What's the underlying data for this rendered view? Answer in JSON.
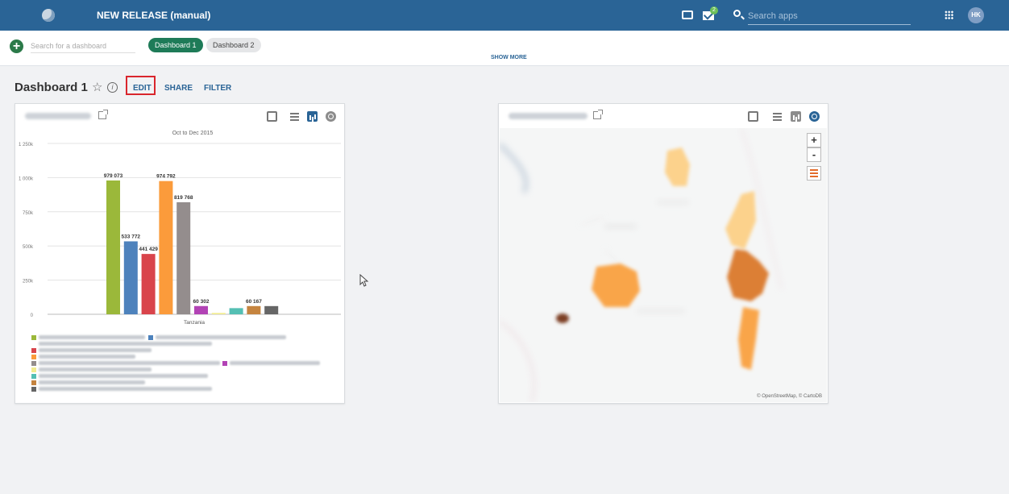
{
  "app": {
    "title": "NEW RELEASE (manual)",
    "notifications": "2",
    "user_initials": "HK"
  },
  "search": {
    "placeholder": "Search apps"
  },
  "dashboards": {
    "search_placeholder": "Search for a dashboard",
    "tabs": [
      "Dashboard 1",
      "Dashboard 2"
    ],
    "show_more": "SHOW MORE"
  },
  "dashboard": {
    "title": "Dashboard 1",
    "actions": {
      "edit": "EDIT",
      "share": "SHARE",
      "filter": "FILTER"
    }
  },
  "map": {
    "attribution": "© OpenStreetMap, © CartoDB"
  },
  "chart_data": {
    "type": "bar",
    "subtitle": "Oct to Dec 2015",
    "categories": [
      "Tanzania"
    ],
    "ylim": [
      0,
      1250000
    ],
    "yticks": [
      "0",
      "250k",
      "500k",
      "750k",
      "1 000k",
      "1 250k"
    ],
    "yticks_values": [
      0,
      250000,
      500000,
      750000,
      1000000,
      1250000
    ],
    "grid": true,
    "series": [
      {
        "value": 979073,
        "label": "979 073",
        "color": "#9bb83a"
      },
      {
        "value": 533772,
        "label": "533 772",
        "color": "#4d82bc"
      },
      {
        "value": 441429,
        "label": "441 429",
        "color": "#d9444b"
      },
      {
        "value": 974792,
        "label": "974 792",
        "color": "#fb9b3b"
      },
      {
        "value": 819768,
        "label": "819 768",
        "color": "#948d8d"
      },
      {
        "value": 60302,
        "label": "60 302",
        "color": "#b243b5"
      },
      {
        "value": 10000,
        "label": "",
        "color": "#f2ec90"
      },
      {
        "value": 45000,
        "label": "",
        "color": "#54bfb3"
      },
      {
        "value": 60167,
        "label": "60 167",
        "color": "#c5843f"
      },
      {
        "value": 60000,
        "label": "",
        "color": "#666666"
      }
    ]
  }
}
